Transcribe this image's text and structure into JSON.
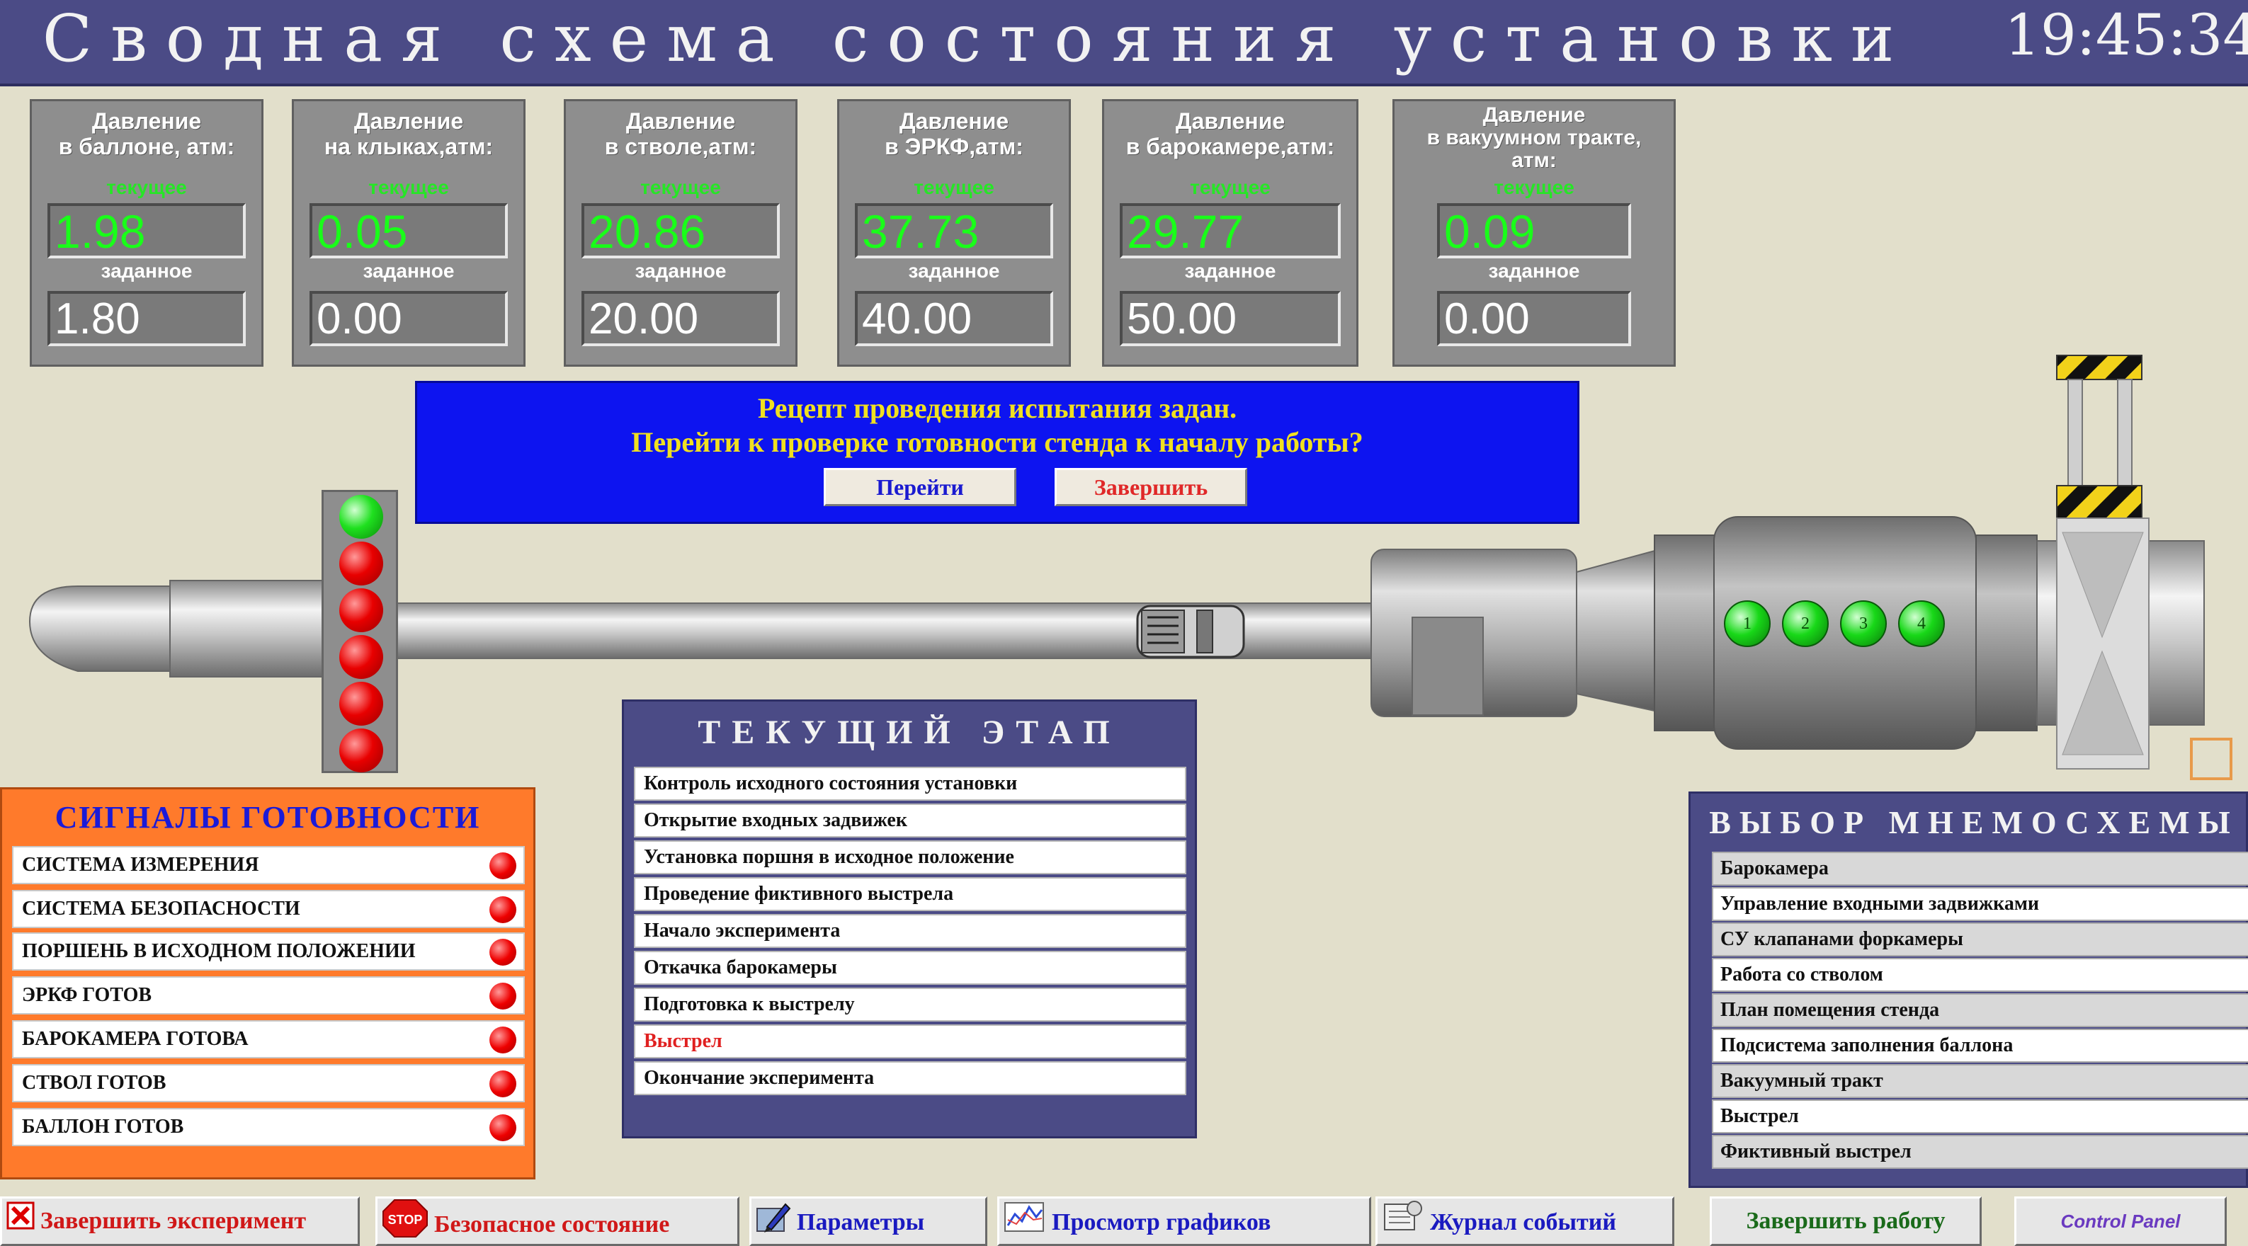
{
  "header": {
    "title": "Сводная схема состояния установки",
    "time": "19:45:34"
  },
  "gauges": [
    {
      "label": "Давление\nв баллоне, атм:",
      "current_caption": "текущее",
      "current": "1.98",
      "setpoint_caption": "заданное",
      "setpoint": "1.80"
    },
    {
      "label": "Давление\nна клыках,атм:",
      "current_caption": "текущее",
      "current": "0.05",
      "setpoint_caption": "заданное",
      "setpoint": "0.00"
    },
    {
      "label": "Давление\nв стволе,атм:",
      "current_caption": "текущее",
      "current": "20.86",
      "setpoint_caption": "заданное",
      "setpoint": "20.00"
    },
    {
      "label": "Давление\nв ЭРКФ,атм:",
      "current_caption": "текущее",
      "current": "37.73",
      "setpoint_caption": "заданное",
      "setpoint": "40.00"
    },
    {
      "label": "Давление\nв барокамере,атм:",
      "current_caption": "текущее",
      "current": "29.77",
      "setpoint_caption": "заданное",
      "setpoint": "50.00"
    },
    {
      "label": "Давление\nв вакуумном тракте,\nатм:",
      "current_caption": "текущее",
      "current": "0.09",
      "setpoint_caption": "заданное",
      "setpoint": "0.00"
    }
  ],
  "dialog": {
    "line1": "Рецепт проведения испытания задан.",
    "line2": "Перейти к проверке готовности стенда к началу работы?",
    "go_label": "Перейти",
    "finish_label": "Завершить"
  },
  "valve_indicators": [
    "1",
    "2",
    "3",
    "4"
  ],
  "readiness": {
    "title": "СИГНАЛЫ ГОТОВНОСТИ",
    "items": [
      "СИСТЕМА ИЗМЕРЕНИЯ",
      "СИСТЕМА БЕЗОПАСНОСТИ",
      "ПОРШЕНЬ В ИСХОДНОМ ПОЛОЖЕНИИ",
      "ЭРКФ ГОТОВ",
      "БАРОКАМЕРА ГОТОВА",
      "СТВОЛ ГОТОВ",
      "БАЛЛОН ГОТОВ"
    ]
  },
  "stage": {
    "title": "ТЕКУЩИЙ ЭТАП",
    "items": [
      "Контроль исходного состояния установки",
      "Открытие входных задвижек",
      "Установка поршня в исходное положение",
      "Проведение фиктивного выстрела",
      "Начало эксперимента",
      "Откачка барокамеры",
      "Подготовка к выстрелу",
      "Выстрел",
      "Окончание эксперимента"
    ],
    "active_index": 7,
    "active_color": "#e02020"
  },
  "mnemo": {
    "title": "ВЫБОР МНЕМОСХЕМЫ",
    "items": [
      "Барокамера",
      "Управление входными задвижками",
      "СУ клапанами форкамеры",
      "Работа со стволом",
      "План помещения стенда",
      "Подсистема заполнения баллона",
      "Вакуумный тракт",
      "Выстрел",
      "Фиктивный выстрел"
    ]
  },
  "toolbar": {
    "finish_experiment": "Завершить эксперимент",
    "safe_state": "Безопасное состояние",
    "safe_state_icon_text": "STOP",
    "parameters": "Параметры",
    "view_graphs": "Просмотр графиков",
    "event_log": "Журнал событий",
    "finish_work": "Завершить работу",
    "control_panel": "Control Panel"
  },
  "colors": {
    "header": "#4b4b86",
    "background": "#e2dfcb",
    "dialog_bg": "#0d14f0",
    "dialog_text": "#f0e020",
    "current_value": "#19ff19",
    "lamp_ok": "#1fe01f",
    "lamp_alarm": "#e80000",
    "readiness_bg": "#ff7a2b"
  }
}
